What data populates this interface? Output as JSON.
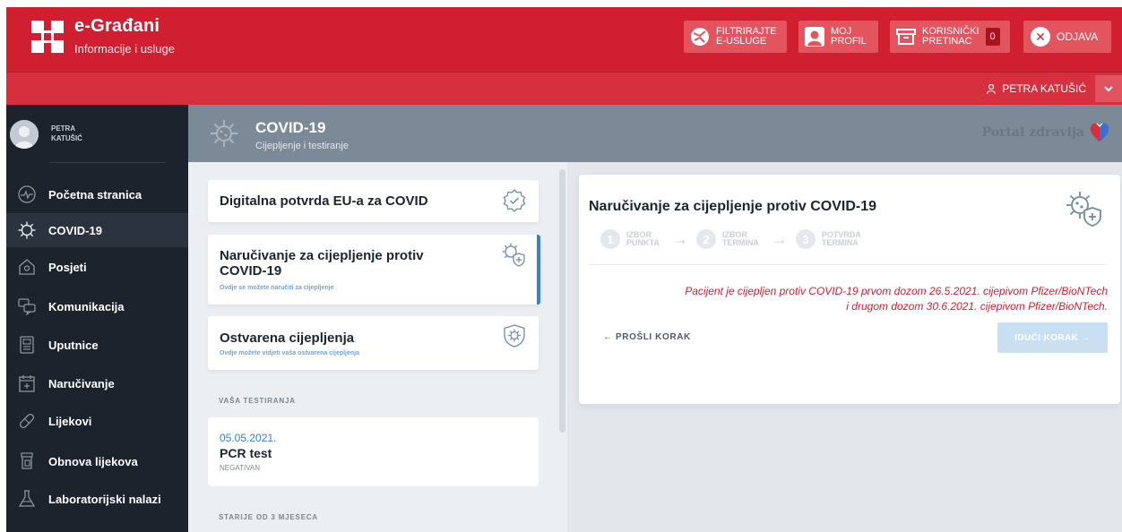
{
  "header": {
    "brand_title": "e-Građani",
    "brand_subtitle": "Informacije i usluge",
    "buttons": {
      "filter": "FILTRIRAJTE\nE-USLUGE",
      "profile": "MOJ\nPROFIL",
      "inbox": "KORISNIČKI\nPRETINAC",
      "inbox_count": "0",
      "logout": "ODJAVA"
    },
    "user_name": "PETRA KATUŠIĆ"
  },
  "sidebar": {
    "user_name": "PETRA KATUŠIĆ",
    "items": [
      {
        "label": "Početna stranica",
        "icon": "pulse-icon"
      },
      {
        "label": "COVID-19",
        "icon": "virus-icon",
        "active": true
      },
      {
        "label": "Posjeti",
        "icon": "house-icon"
      },
      {
        "label": "Komunikacija",
        "icon": "chat-icon"
      },
      {
        "label": "Uputnice",
        "icon": "document-icon"
      },
      {
        "label": "Naručivanje",
        "icon": "calendar-icon"
      },
      {
        "label": "Lijekovi",
        "icon": "pill-icon"
      },
      {
        "label": "Obnova lijekova",
        "icon": "prescription-icon"
      },
      {
        "label": "Laboratorijski nalazi",
        "icon": "flask-icon"
      }
    ]
  },
  "content_header": {
    "title": "COVID-19",
    "subtitle": "Cijepljenje i testiranje",
    "portal_label": "Portal zdravlja"
  },
  "cards": [
    {
      "title": "Digitalna potvrda EU-a za COVID",
      "description": "",
      "icon": "certificate-badge-icon"
    },
    {
      "title": "Naručivanje za cijepljenje protiv COVID-19",
      "description": "Ovdje se možete naručiti za cijepljenje",
      "icon": "virus-shield-icon",
      "selected": true
    },
    {
      "title": "Ostvarena cijepljenja",
      "description": "Ovdje možete vidjeti vaša ostvarena cijepljenja",
      "icon": "shield-virus-icon"
    }
  ],
  "sections": {
    "testing": "VAŠA TESTIRANJA",
    "older": "STARIJE OD 3 MJESECA"
  },
  "tests": [
    {
      "date": "05.05.2021.",
      "name": "PCR test",
      "result": "NEGATIVAN"
    }
  ],
  "panel": {
    "title": "Naručivanje za cijepljenje protiv COVID-19",
    "steps": [
      {
        "number": "1",
        "label": "IZBOR\nPUNKTA"
      },
      {
        "number": "2",
        "label": "IZBOR\nTERMINA"
      },
      {
        "number": "3",
        "label": "POTVRDA\nTERMINA"
      }
    ],
    "message_line1": "Pacijent je cijepljen protiv COVID-19 prvom dozom 26.5.2021. cijepivom Pfizer/BioNTech",
    "message_line2": "i drugom dozom 30.6.2021. cijepivom Pfizer/BioNTech.",
    "prev_label": "← PROŠLI KORAK",
    "next_label": "IDUĆI KORAK →"
  },
  "colors": {
    "brand_red": "#cf1f31",
    "sidebar_bg": "#1c232c",
    "accent_blue": "#3b80c6"
  }
}
